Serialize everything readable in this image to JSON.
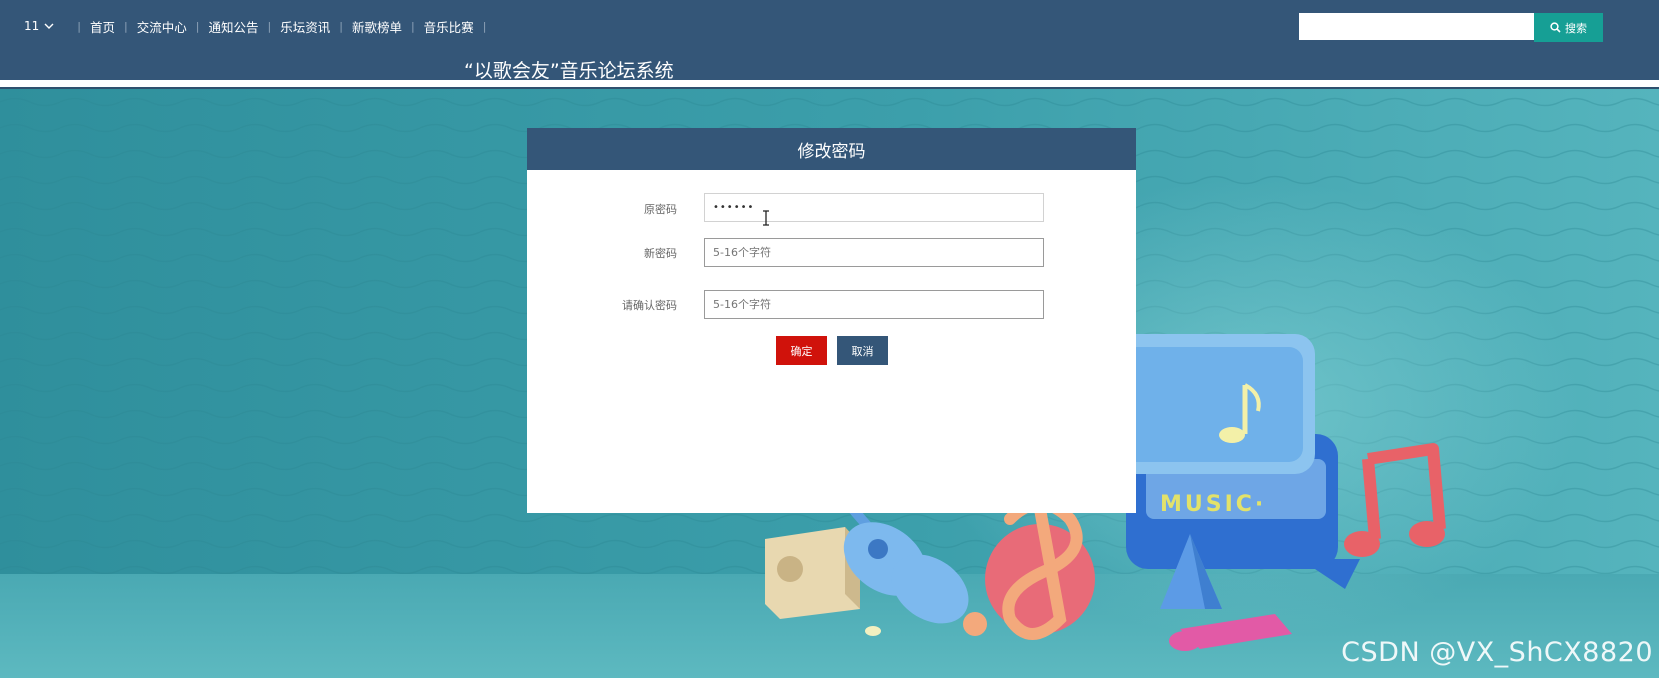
{
  "header": {
    "user_menu": "11",
    "nav_items": [
      "首页",
      "交流中心",
      "通知公告",
      "乐坛资讯",
      "新歌榜单",
      "音乐比赛"
    ],
    "site_title": "“以歌会友”音乐论坛系统",
    "search": {
      "placeholder": "",
      "button_label": "搜索"
    }
  },
  "card": {
    "title": "修改密码",
    "fields": [
      {
        "label": "原密码",
        "value": "••••••",
        "placeholder": ""
      },
      {
        "label": "新密码",
        "value": "",
        "placeholder": "5-16个字符"
      },
      {
        "label": "请确认密码",
        "value": "",
        "placeholder": "5-16个字符"
      }
    ],
    "confirm_label": "确定",
    "cancel_label": "取消"
  },
  "background": {
    "music_sign": "MUSIC·"
  },
  "watermark": "CSDN @VX_ShCX8820",
  "colors": {
    "header": "#345678",
    "search_button": "#169f95",
    "confirm_button": "#d0120b",
    "cancel_button": "#345678",
    "background": "#3a9aa7"
  }
}
